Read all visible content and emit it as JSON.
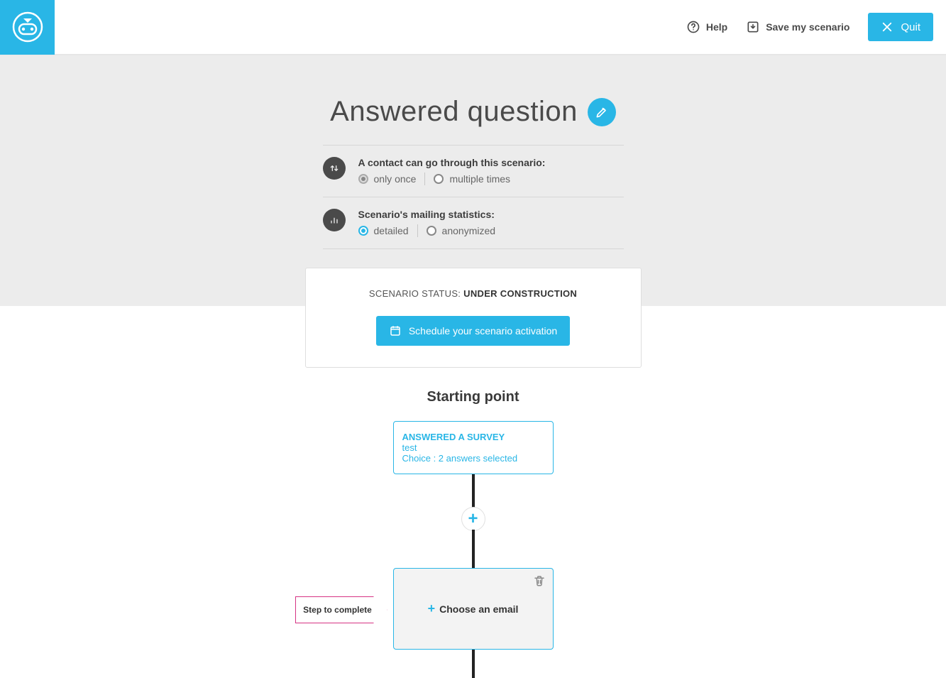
{
  "header": {
    "help": "Help",
    "save": "Save my scenario",
    "quit": "Quit"
  },
  "title": "Answered question",
  "settings": {
    "pass": {
      "label": "A contact can go through this scenario:",
      "once": "only once",
      "multi": "multiple times"
    },
    "stats": {
      "label": "Scenario's mailing statistics:",
      "detailed": "detailed",
      "anon": "anonymized"
    }
  },
  "status": {
    "prefix": "SCENARIO STATUS: ",
    "value": "UNDER CONSTRUCTION",
    "button": "Schedule your scenario activation"
  },
  "flow": {
    "heading": "Starting point",
    "start": {
      "line1": "ANSWERED A SURVEY",
      "line2": "test",
      "line3": "Choice : 2 answers selected"
    },
    "step_tag": "Step to complete",
    "choose_email": "Choose an email"
  }
}
